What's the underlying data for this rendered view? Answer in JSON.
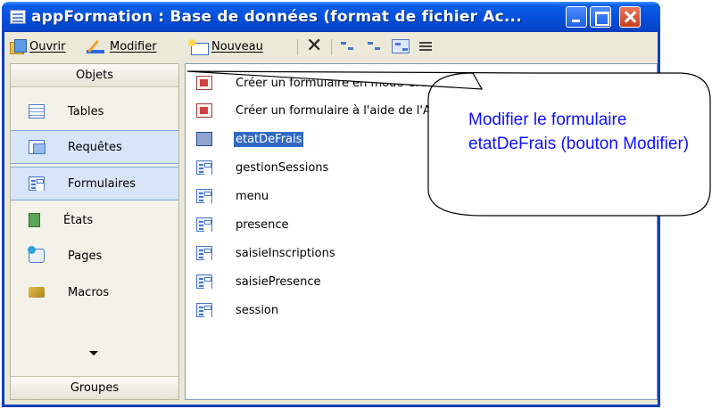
{
  "window": {
    "title": "appFormation : Base de données (format de fichier Ac...",
    "controls": {
      "minimize": "minimize-icon",
      "maximize": "maximize-icon",
      "close": "close-icon"
    }
  },
  "toolbar": {
    "open_label": "Ouvrir",
    "modify_label": "Modifier",
    "new_label": "Nouveau",
    "icons": [
      "open-icon",
      "design-icon",
      "new-icon",
      "delete-icon",
      "large-icons-icon",
      "small-icons-icon",
      "list-view-icon",
      "details-view-icon"
    ]
  },
  "objects_pane": {
    "header": "Objets",
    "items": [
      {
        "label": "Tables",
        "icon": "table-icon"
      },
      {
        "label": "Requêtes",
        "icon": "query-icon"
      },
      {
        "label": "Formulaires",
        "icon": "form-icon"
      },
      {
        "label": "États",
        "icon": "report-icon"
      },
      {
        "label": "Pages",
        "icon": "pages-icon"
      },
      {
        "label": "Macros",
        "icon": "macro-icon"
      }
    ],
    "footer": "Groupes"
  },
  "forms_list": {
    "items": [
      {
        "label": "Créer un formulaire en mode Création",
        "icon": "wizard-icon"
      },
      {
        "label": "Créer un formulaire à l'aide de l'Assistant",
        "icon": "wizard-icon"
      },
      {
        "label": "etatDeFrais",
        "icon": "form-icon"
      },
      {
        "label": "gestionSessions",
        "icon": "form-icon"
      },
      {
        "label": "menu",
        "icon": "form-icon"
      },
      {
        "label": "presence",
        "icon": "form-icon"
      },
      {
        "label": "saisieInscriptions",
        "icon": "form-icon"
      },
      {
        "label": "saisiePresence",
        "icon": "form-icon"
      },
      {
        "label": "session",
        "icon": "form-icon"
      }
    ]
  },
  "callout": {
    "text": "Modifier le formulaire etatDeFrais (bouton Modifier)",
    "color": "#1010ff"
  }
}
